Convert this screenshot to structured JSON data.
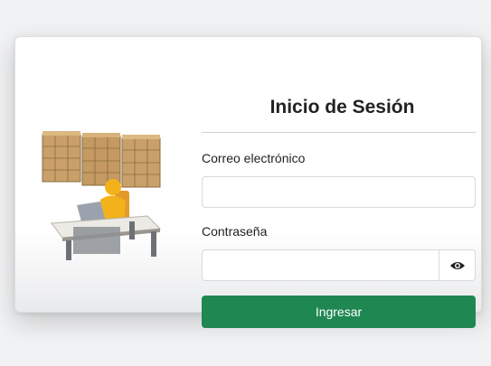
{
  "login": {
    "title": "Inicio de Sesión",
    "email_label": "Correo electrónico",
    "email_value": "",
    "password_label": "Contraseña",
    "password_value": "",
    "submit_label": "Ingresar"
  },
  "icons": {
    "password_toggle": "eye-icon",
    "illustration": "warehouse-worker-illustration"
  },
  "colors": {
    "primary_button": "#1f8752",
    "background": "#f1f2f3",
    "card": "#ffffff"
  }
}
